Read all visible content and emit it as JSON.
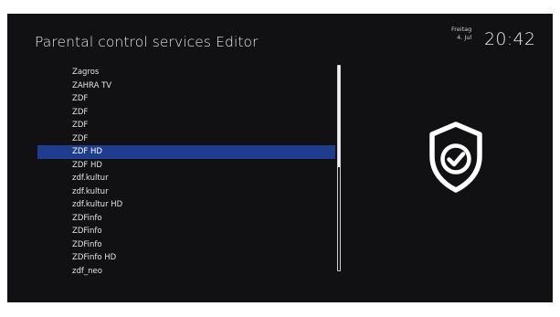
{
  "header": {
    "title": "Parental control services Editor",
    "day": "Freitag",
    "date": "4. Jul",
    "time": "20:42"
  },
  "channels": [
    "Zagros",
    "ZAHRA TV",
    "ZDF",
    "ZDF",
    "ZDF",
    "ZDF",
    "ZDF HD",
    "ZDF HD",
    "zdf.kultur",
    "zdf.kultur",
    "zdf.kultur HD",
    "ZDFinfo",
    "ZDFinfo",
    "ZDFinfo",
    "ZDFinfo HD",
    "zdf_neo"
  ],
  "selected_index": 6,
  "icon": "shield-check-icon",
  "colors": {
    "background": "#111113",
    "selection": "#1e3d8f",
    "text": "#e2e2e2"
  }
}
